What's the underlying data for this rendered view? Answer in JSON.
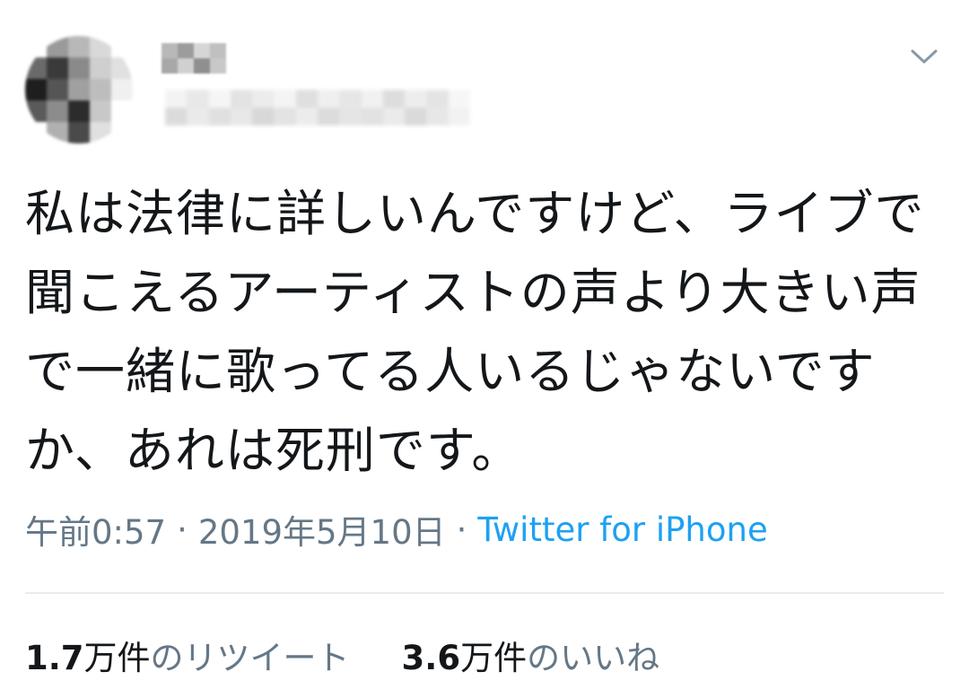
{
  "header": {
    "menu_icon": "chevron-down-icon"
  },
  "tweet": {
    "text": "私は法律に詳しいんですけど、ライブで聞こえるアーティストの声より大きい声で一緒に歌ってる人いるじゃないですか、あれは死刑です。",
    "time": "午前0:57",
    "separator": "·",
    "date": "2019年5月10日",
    "source": "Twitter for iPhone"
  },
  "stats": {
    "retweets": {
      "count": "1.7",
      "unit": "万件",
      "label": "のリツイート"
    },
    "likes": {
      "count": "3.6",
      "unit": "万件",
      "label": "のいいね"
    }
  },
  "colors": {
    "text": "#14171a",
    "secondary": "#657786",
    "link": "#1da1f2",
    "divider": "#e6ecf0"
  }
}
